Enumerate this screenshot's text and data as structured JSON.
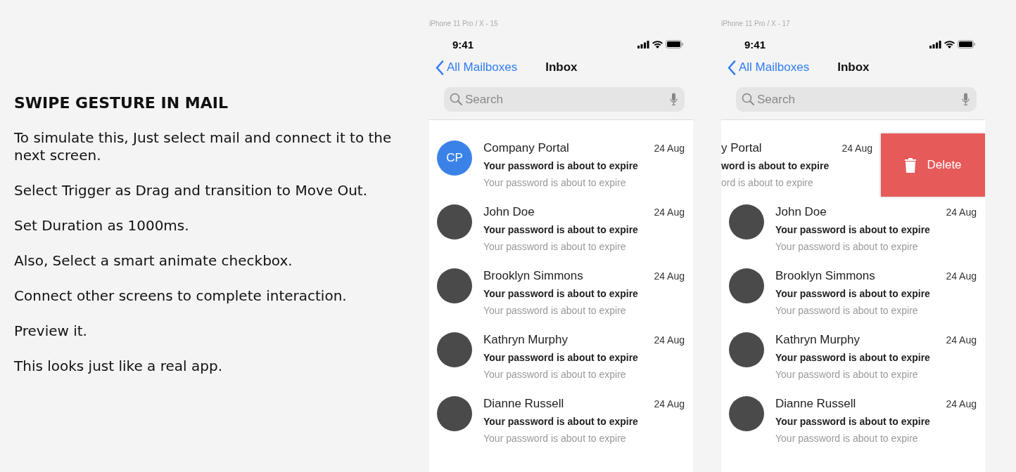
{
  "instructions": {
    "heading": "SWIPE GESTURE IN MAIL",
    "steps": [
      "To simulate this, Just select mail and connect it to the next screen.",
      "Select Trigger as Drag and transition to Move Out.",
      "Set Duration as 1000ms.",
      "Also, Select a smart animate checkbox.",
      "Connect other screens to complete interaction.",
      "Preview it.",
      "This looks just like a real app."
    ]
  },
  "screens": [
    {
      "frame_label": "iPhone 11 Pro / X - 15",
      "status_time": "9:41",
      "back_label": "All Mailboxes",
      "title": "Inbox",
      "search_placeholder": "Search",
      "messages": [
        {
          "kind": "normal",
          "avatar": {
            "kind": "initials",
            "text": "CP"
          },
          "sender": "Company Portal",
          "date": "24 Aug",
          "subject": "Your password is about to expire",
          "preview": "Your password is about to expire"
        },
        {
          "kind": "normal",
          "avatar": {
            "kind": "photo"
          },
          "sender": "John Doe",
          "date": "24 Aug",
          "subject": "Your password is about to expire",
          "preview": "Your password is about to expire"
        },
        {
          "kind": "normal",
          "avatar": {
            "kind": "photo"
          },
          "sender": "Brooklyn Simmons",
          "date": "24 Aug",
          "subject": "Your password is about to expire",
          "preview": "Your password is about to expire"
        },
        {
          "kind": "normal",
          "avatar": {
            "kind": "photo"
          },
          "sender": "Kathryn Murphy",
          "date": "24 Aug",
          "subject": "Your password is about to expire",
          "preview": "Your password is about to expire"
        },
        {
          "kind": "normal",
          "avatar": {
            "kind": "photo"
          },
          "sender": "Dianne Russell",
          "date": "24 Aug",
          "subject": "Your password is about to expire",
          "preview": "Your password is about to expire"
        }
      ]
    },
    {
      "frame_label": "iPhone 11 Pro / X - 17",
      "status_time": "9:41",
      "back_label": "All Mailboxes",
      "title": "Inbox",
      "search_placeholder": "Search",
      "messages": [
        {
          "kind": "swiped",
          "sender": "y Portal",
          "date": "24 Aug",
          "subject": "word is about to expire",
          "preview": "ord is about to expire",
          "action": "Delete"
        },
        {
          "kind": "normal",
          "avatar": {
            "kind": "photo"
          },
          "sender": "John Doe",
          "date": "24 Aug",
          "subject": "Your password is about to expire",
          "preview": "Your password is about to expire"
        },
        {
          "kind": "normal",
          "avatar": {
            "kind": "photo"
          },
          "sender": "Brooklyn Simmons",
          "date": "24 Aug",
          "subject": "Your password is about to expire",
          "preview": "Your password is about to expire"
        },
        {
          "kind": "normal",
          "avatar": {
            "kind": "photo"
          },
          "sender": "Kathryn Murphy",
          "date": "24 Aug",
          "subject": "Your password is about to expire",
          "preview": "Your password is about to expire"
        },
        {
          "kind": "normal",
          "avatar": {
            "kind": "photo"
          },
          "sender": "Dianne Russell",
          "date": "24 Aug",
          "subject": "Your password is about to expire",
          "preview": "Your password is about to expire"
        }
      ]
    }
  ]
}
